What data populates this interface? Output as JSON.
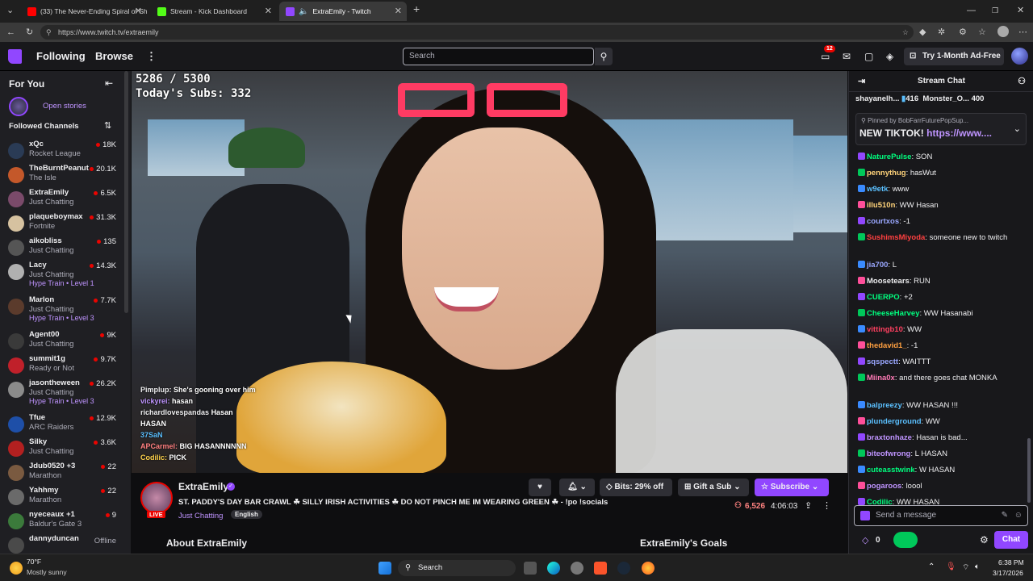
{
  "browser": {
    "tabs": [
      {
        "label": "(33) The Never-Ending Spiral of Sh",
        "icon": "youtube-icon"
      },
      {
        "label": "Stream - Kick Dashboard",
        "icon": "kick-icon"
      },
      {
        "label": "ExtraEmily - Twitch",
        "icon": "twitch-icon"
      }
    ],
    "url": "https://www.twitch.tv/extraemily"
  },
  "topnav": {
    "following": "Following",
    "browse": "Browse",
    "search_placeholder": "Search",
    "notifications_count": "12",
    "adfree_label": "Try 1-Month Ad-Free"
  },
  "sidebar": {
    "for_you": "For You",
    "open_stories": "Open stories",
    "followed_channels": "Followed Channels",
    "channels": [
      {
        "name": "xQc",
        "game": "Rocket League",
        "viewers": "18K",
        "hype": "",
        "color": "#2a3b55"
      },
      {
        "name": "TheBurntPeanut",
        "game": "The Isle",
        "viewers": "20.1K",
        "hype": "",
        "color": "#c4582a"
      },
      {
        "name": "ExtraEmily",
        "game": "Just Chatting",
        "viewers": "6.5K",
        "hype": "",
        "color": "#7a4a6a"
      },
      {
        "name": "plaqueboymax",
        "game": "Fortnite",
        "viewers": "31.3K",
        "hype": "",
        "color": "#d6c2a0"
      },
      {
        "name": "aikobliss",
        "game": "Just Chatting",
        "viewers": "135",
        "hype": "",
        "color": "#555"
      },
      {
        "name": "Lacy",
        "game": "Just Chatting",
        "viewers": "14.3K",
        "hype": "Hype Train • Level 1",
        "color": "#b0b0b0"
      },
      {
        "name": "Marlon",
        "game": "Just Chatting",
        "viewers": "7.7K",
        "hype": "Hype Train • Level 3",
        "color": "#5b3b2c"
      },
      {
        "name": "Agent00",
        "game": "Just Chatting",
        "viewers": "9K",
        "hype": "",
        "color": "#3a3a3a"
      },
      {
        "name": "summit1g",
        "game": "Ready or Not",
        "viewers": "9.7K",
        "hype": "",
        "color": "#c0202a"
      },
      {
        "name": "jasontheween",
        "game": "Just Chatting",
        "viewers": "26.2K",
        "hype": "Hype Train • Level 3",
        "color": "#8b8b8b"
      },
      {
        "name": "Tfue",
        "game": "ARC Raiders",
        "viewers": "12.9K",
        "hype": "",
        "color": "#1e4fa8"
      },
      {
        "name": "Silky",
        "game": "Just Chatting",
        "viewers": "3.6K",
        "hype": "",
        "color": "#b32020"
      },
      {
        "name": "Jdub0520 +3",
        "game": "Marathon",
        "viewers": "22",
        "hype": "",
        "color": "#7a5a40"
      },
      {
        "name": "Yahhmy",
        "game": "Marathon",
        "viewers": "22",
        "hype": "",
        "color": "#6a6a6a"
      },
      {
        "name": "nyeceaux +1",
        "game": "Baldur's Gate 3",
        "viewers": "9",
        "hype": "",
        "color": "#3b7a3b"
      },
      {
        "name": "dannyduncan",
        "game": "",
        "viewers": "Offline",
        "hype": "",
        "color": "#4a4a4a"
      }
    ]
  },
  "video": {
    "sub_goal": "5286 / 5300",
    "todays_subs": "Today's Subs: 332",
    "overlay_chat": [
      {
        "user": "Pimplup:",
        "text": "She's gooning over him"
      },
      {
        "user": "vickyrei:",
        "text": "hasan"
      },
      {
        "user": "richardlovespandas",
        "text": "Hasan"
      },
      {
        "user": "",
        "text": "HASAN"
      },
      {
        "user": "37SaN",
        "text": ""
      },
      {
        "user": "APCarmel:",
        "text": "BIG HASANNNNNN"
      },
      {
        "user": "Codilic:",
        "text": "PICK"
      }
    ]
  },
  "stream": {
    "channel": "ExtraEmily",
    "live": "LIVE",
    "title": "ST. PADDY'S DAY BAR CRAWL ☘ SILLY IRISH ACTIVITIES ☘ DO NOT PINCH ME IM WEARING GREEN ☘ - !po !socials",
    "category": "Just Chatting",
    "tag": "English",
    "bits_label": "Bits: 29% off",
    "gift_label": "Gift a Sub",
    "subscribe_label": "Subscribe",
    "viewers": "6,526",
    "uptime": "4:06:03",
    "about": "About ExtraEmily",
    "goals": "ExtraEmily's Goals"
  },
  "chat": {
    "header": "Stream Chat",
    "leaderboard": [
      {
        "name": "shayanelh...",
        "count": "416"
      },
      {
        "name": "Monster_O...",
        "count": "400"
      }
    ],
    "pinned_by": "Pinned by",
    "pinned_user": "BobFarrFuturePopSup...",
    "pinned_text": "NEW TIKTOK!",
    "pinned_link": "https://www....",
    "messages": [
      {
        "user": "NaturePulse",
        "color": "#00ff7f",
        "text": "SON"
      },
      {
        "user": "pennythug",
        "color": "#ffd37a",
        "text": "hasWut"
      },
      {
        "user": "w9etk",
        "color": "#5bc0ff",
        "text": "www"
      },
      {
        "user": "illu510n",
        "color": "#ffd37a",
        "text": "WW Hasan"
      },
      {
        "user": "courtxos",
        "color": "#9aa7ff",
        "text": "-1"
      },
      {
        "user": "SushimsMiyoda",
        "color": "#ff4040",
        "text": "someone new to twitch"
      },
      {
        "user": "jia700",
        "color": "#9aa7ff",
        "text": "L"
      },
      {
        "user": "Moosetears",
        "color": "#efeff1",
        "text": "RUN"
      },
      {
        "user": "CUERPO",
        "color": "#00ff7f",
        "text": "+2"
      },
      {
        "user": "CheeseHarvey",
        "color": "#00ff7f",
        "text": "WW Hasanabi"
      },
      {
        "user": "vittingb10",
        "color": "#ff4060",
        "text": "WW"
      },
      {
        "user": "thedavid1_",
        "color": "#ffa040",
        "text": "-1"
      },
      {
        "user": "sqspectt",
        "color": "#9aa7ff",
        "text": "WAITTT"
      },
      {
        "user": "Miina0x",
        "color": "#ff7ab6",
        "text": "and there goes chat MONKA"
      },
      {
        "user": "balpreezy",
        "color": "#5bc0ff",
        "text": "WW HASAN !!!"
      },
      {
        "user": "plunderground",
        "color": "#5bc0ff",
        "text": "WW"
      },
      {
        "user": "braxtonhaze",
        "color": "#bf94ff",
        "text": "Hasan is bad..."
      },
      {
        "user": "biteofwrong",
        "color": "#bf94ff",
        "text": "L HASAN"
      },
      {
        "user": "cuteasstwink",
        "color": "#00ff7f",
        "text": "W HASAN"
      },
      {
        "user": "pogaroos",
        "color": "#bf94ff",
        "text": "loool"
      },
      {
        "user": "Codilic",
        "color": "#00ff7f",
        "text": "WW HASAN"
      }
    ],
    "input_placeholder": "Send a message",
    "points": "0",
    "chat_button": "Chat"
  },
  "taskbar": {
    "weather_temp": "70°F",
    "weather_desc": "Mostly sunny",
    "search": "Search",
    "time": "6:38 PM",
    "date": "3/17/2026"
  },
  "colors": {
    "twitch_purple": "#9147ff",
    "live_red": "#eb0400"
  }
}
